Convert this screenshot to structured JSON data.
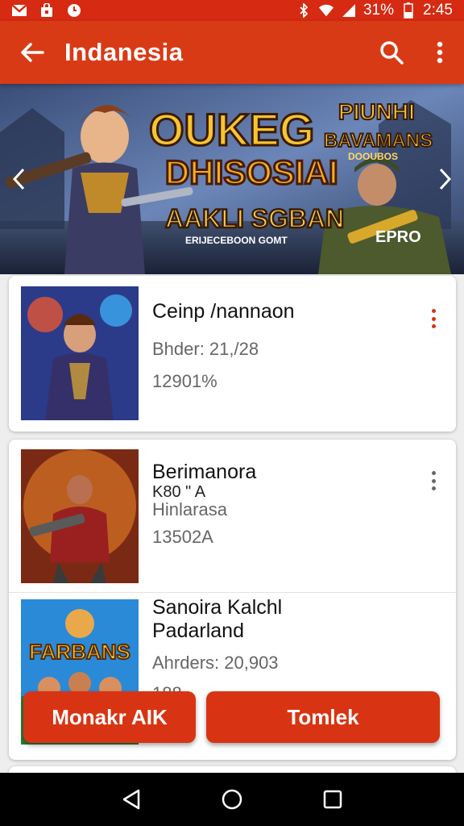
{
  "status_bar": {
    "battery": "31%",
    "time": "2:45",
    "icons": [
      "gmail-icon",
      "store-icon",
      "clock-icon",
      "bluetooth-icon",
      "wifi-icon",
      "signal-icon",
      "battery-icon"
    ]
  },
  "appbar": {
    "title": "Indanesia",
    "icons": [
      "back-arrow-icon",
      "search-icon",
      "more-vert-icon"
    ]
  },
  "banner": {
    "headline_1": "OUKEG",
    "headline_2": "DHISOSIAI",
    "subtitle": "AAKLI SGBAN",
    "tagline": "ERIJECEBOON GOMT",
    "side_title_1": "PIUNHI",
    "side_title_2": "BAVAMANS",
    "side_title_3": "DOOUBOS",
    "badge": "EPRO"
  },
  "list": [
    {
      "title": "Ceinp /nannaon",
      "line1": "Bhder: 21,/28",
      "line2": "12901%",
      "kebab_color": "#d83413"
    },
    {
      "title": "Berimanora",
      "line1": "K80 \" A",
      "line2": "Hinlarasa",
      "line3": "13502A",
      "kebab_color": "#666666"
    },
    {
      "title": "Sanoira Kalchl",
      "title2": "Padarland",
      "line1": "Ahrders: 20,903",
      "line2": "188",
      "thumb_text": "FARBANS"
    }
  ],
  "buttons": {
    "primary_left": "Monakr AIK",
    "primary_right": "Tomlek"
  },
  "colors": {
    "accent": "#d93a16",
    "status_bar": "#d62a12",
    "background": "#eeeeee"
  }
}
